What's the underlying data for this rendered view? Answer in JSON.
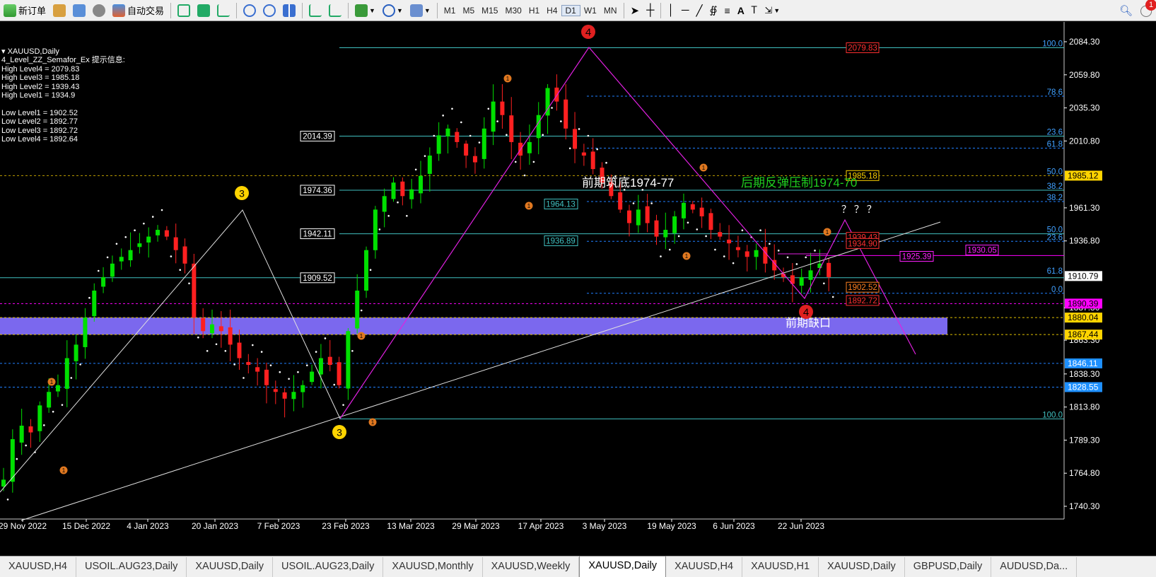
{
  "toolbar": {
    "new_order": "新订单",
    "auto_trading": "自动交易",
    "timeframes": [
      "M1",
      "M5",
      "M15",
      "M30",
      "H1",
      "H4",
      "D1",
      "W1",
      "MN"
    ],
    "active_timeframe": "D1",
    "notification_count": "1"
  },
  "chart": {
    "symbol_title": "XAUUSD,Daily",
    "indicator_info": [
      "4_Level_ZZ_Semafor_Ex 提示信息:",
      "High Level4 = 2079.83",
      "High Level3 = 1985.18",
      "High Level2 = 1939.43",
      "High Level1 = 1934.9",
      "",
      "Low Level1 = 1902.52",
      "Low Level2 = 1892.77",
      "Low Level3 = 1892.72",
      "Low Level4 = 1892.64"
    ],
    "price_axis_labels": [
      "2084.30",
      "2059.80",
      "2035.30",
      "2010.80",
      "1961.30",
      "1936.80",
      "1887.30",
      "1863.30",
      "1838.30",
      "1813.80",
      "1789.30",
      "1764.80",
      "1740.30"
    ],
    "price_tags": [
      {
        "text": "1985.12",
        "bg": "#ffd400",
        "fg": "#000"
      },
      {
        "text": "1910.79",
        "bg": "#ffffff",
        "fg": "#000"
      },
      {
        "text": "1890.39",
        "bg": "#ff00ff",
        "fg": "#000"
      },
      {
        "text": "1880.04",
        "bg": "#ffd400",
        "fg": "#000"
      },
      {
        "text": "1867.44",
        "bg": "#ffd400",
        "fg": "#000"
      },
      {
        "text": "1846.11",
        "bg": "#1e90ff",
        "fg": "#fff"
      },
      {
        "text": "1828.55",
        "bg": "#1e90ff",
        "fg": "#fff"
      }
    ],
    "date_axis_labels": [
      "29 Nov 2022",
      "15 Dec 2022",
      "4 Jan 2023",
      "20 Jan 2023",
      "7 Feb 2023",
      "23 Feb 2023",
      "13 Mar 2023",
      "29 Mar 2023",
      "17 Apr 2023",
      "3 May 2023",
      "19 May 2023",
      "6 Jun 2023",
      "22 Jun 2023"
    ],
    "level_boxes": [
      "2014.39",
      "1974.36",
      "1942.11",
      "1909.52"
    ],
    "inner_boxes": [
      "1964.13",
      "1936.89"
    ],
    "fib_right": [
      "100.0",
      "78.6",
      "23.6",
      "61.8",
      "50.0",
      "38.2",
      "38.2",
      "50.0",
      "23.6",
      "61.8",
      "0.0"
    ],
    "fib_low_label": "100.0",
    "right_boxes": {
      "top_red": "2079.83",
      "yellow": "1985.18",
      "red1": "1939.43",
      "red2": "1934.90",
      "magenta1": "1925.39",
      "magenta2": "1930.05",
      "orange": "1902.52",
      "red_low": "1892.72"
    },
    "annotations": {
      "support_text": "前期筑底1974-77",
      "resistance_text": "后期反弹压制1974-70",
      "gap_text": "前期缺口",
      "question": "？ ？ ？"
    },
    "wave_marks": {
      "four": "4",
      "three": "3",
      "one": "1"
    }
  },
  "tabs": [
    "XAUUSD,H4",
    "USOIL.AUG23,Daily",
    "XAUUSD,Daily",
    "USOIL.AUG23,Daily",
    "XAUUSD,Monthly",
    "XAUUSD,Weekly",
    "XAUUSD,Daily",
    "XAUUSD,H4",
    "XAUUSD,H1",
    "XAUUSD,Daily",
    "GBPUSD,Daily",
    "AUDUSD,Da..."
  ],
  "active_tab_index": 6,
  "chart_data": {
    "type": "candlestick",
    "title": "XAUUSD,Daily",
    "y_range": [
      1730,
      2090
    ],
    "x_categories": [
      "29 Nov 2022",
      "15 Dec 2022",
      "4 Jan 2023",
      "20 Jan 2023",
      "7 Feb 2023",
      "23 Feb 2023",
      "13 Mar 2023",
      "29 Mar 2023",
      "17 Apr 2023",
      "3 May 2023",
      "19 May 2023",
      "6 Jun 2023",
      "22 Jun 2023"
    ],
    "close_path": [
      1760,
      1790,
      1800,
      1795,
      1815,
      1825,
      1830,
      1850,
      1860,
      1880,
      1900,
      1910,
      1920,
      1925,
      1930,
      1935,
      1940,
      1945,
      1940,
      1930,
      1920,
      1880,
      1870,
      1875,
      1870,
      1860,
      1850,
      1845,
      1840,
      1830,
      1825,
      1820,
      1825,
      1830,
      1840,
      1850,
      1845,
      1830,
      1870,
      1900,
      1930,
      1960,
      1970,
      1980,
      1970,
      1975,
      1985,
      2000,
      2015,
      2020,
      2010,
      2000,
      1995,
      2020,
      2040,
      2030,
      2010,
      2000,
      2010,
      2030,
      2050,
      2040,
      2020,
      2005,
      2000,
      1990,
      1980,
      1970,
      1960,
      1950,
      1960,
      1950,
      1940,
      1945,
      1955,
      1965,
      1960,
      1955,
      1945,
      1940,
      1935,
      1930,
      1925,
      1930,
      1920,
      1915,
      1910,
      1905,
      1910,
      1915,
      1920,
      1910
    ],
    "last_price": 1910.79
  }
}
